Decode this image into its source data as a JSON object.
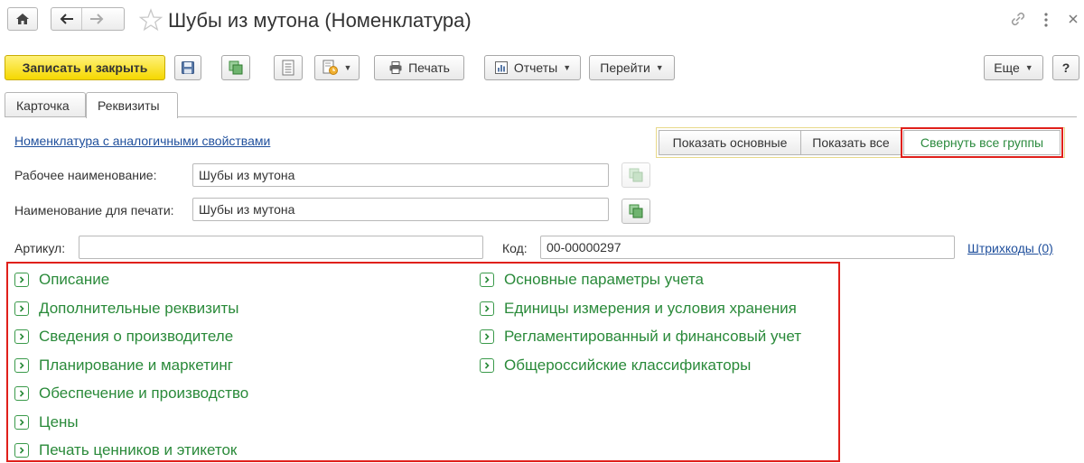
{
  "window": {
    "title": "Шубы из мутона (Номенклатура)"
  },
  "toolbar": {
    "save_close_label": "Записать и закрыть",
    "print_label": "Печать",
    "reports_label": "Отчеты",
    "goto_label": "Перейти",
    "more_label": "Еще",
    "help_label": "?"
  },
  "tabs": [
    {
      "label": "Карточка",
      "active": false
    },
    {
      "label": "Реквизиты",
      "active": true
    }
  ],
  "links": {
    "similar": "Номенклатура с аналогичными свойствами",
    "barcodes": "Штрихкоды (0)"
  },
  "view_modes": [
    {
      "label": "Показать основные",
      "selected": false
    },
    {
      "label": "Показать все",
      "selected": false
    },
    {
      "label": "Свернуть все группы",
      "selected": true
    }
  ],
  "fields": {
    "work_name_label": "Рабочее наименование:",
    "work_name_value": "Шубы из мутона",
    "print_name_label": "Наименование для печати:",
    "print_name_value": "Шубы из мутона",
    "article_label": "Артикул:",
    "article_value": "",
    "code_label": "Код:",
    "code_value": "00-00000297"
  },
  "groups_left": [
    "Описание",
    "Дополнительные реквизиты",
    "Сведения о производителе",
    "Планирование и маркетинг",
    "Обеспечение и производство",
    "Цены",
    "Печать ценников и этикеток"
  ],
  "groups_right": [
    "Основные параметры учета",
    "Единицы измерения и условия хранения",
    "Регламентированный и финансовый учет",
    "Общероссийские классификаторы"
  ],
  "colors": {
    "group_text": "#2a8a3a",
    "highlight": "#e0201b",
    "primary_button": "#f5d800",
    "link": "#1f4f9c"
  }
}
